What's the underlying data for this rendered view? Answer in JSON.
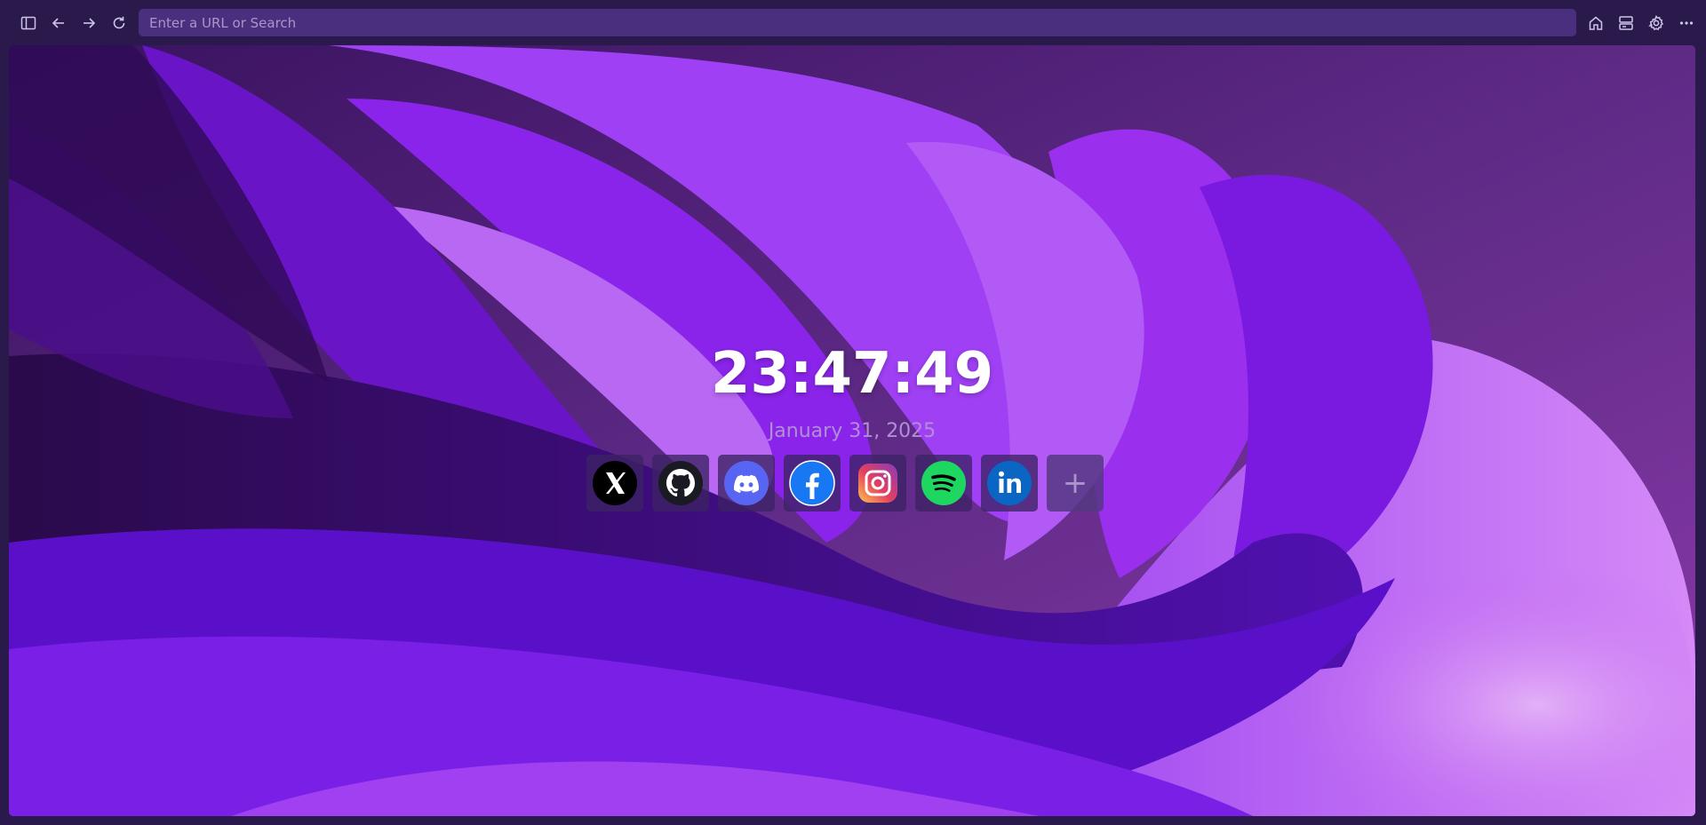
{
  "toolbar": {
    "url_placeholder": "Enter a URL or Search",
    "url_value": "",
    "icons": {
      "sidebar": "sidebar-toggle-icon",
      "back": "arrow-left-icon",
      "forward": "arrow-right-icon",
      "reload": "reload-icon",
      "home": "home-icon",
      "panels": "panels-icon",
      "settings": "gear-icon",
      "more": "more-dots-icon"
    }
  },
  "newtab": {
    "time": "23:47:49",
    "date": "January 31, 2025",
    "shortcuts": [
      {
        "name": "X",
        "icon": "x-twitter-icon",
        "color": "#000000"
      },
      {
        "name": "GitHub",
        "icon": "github-icon",
        "color": "#24292f"
      },
      {
        "name": "Discord",
        "icon": "discord-icon",
        "color": "#5865f2"
      },
      {
        "name": "Facebook",
        "icon": "facebook-icon",
        "color": "#1877f2"
      },
      {
        "name": "Instagram",
        "icon": "instagram-icon",
        "color": "#e4405f"
      },
      {
        "name": "Spotify",
        "icon": "spotify-icon",
        "color": "#1ed760"
      },
      {
        "name": "LinkedIn",
        "icon": "linkedin-icon",
        "color": "#0a66c2"
      }
    ],
    "add_label": "+"
  },
  "theme": {
    "toolbar_bg": "#2a1a4c",
    "urlbar_bg": "#4a2f7f",
    "accent": "#8a2be2"
  }
}
